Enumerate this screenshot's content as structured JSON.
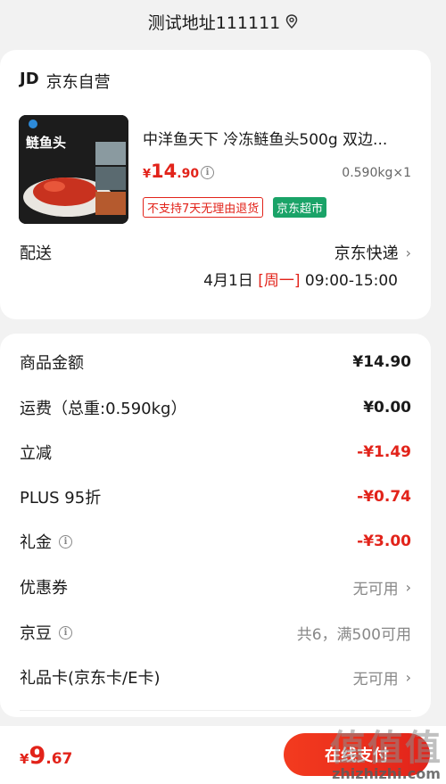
{
  "header": {
    "address": "测试地址111111"
  },
  "shop": {
    "logo": "JD",
    "name": "京东自营"
  },
  "product": {
    "title": "中洋鱼天下 冷冻鲢鱼头500g 双边...",
    "image_label": "鲢鱼头",
    "price_symbol": "¥",
    "price_int": "14",
    "price_dec": ".90",
    "quantity": "0.590kg×1",
    "tag_return": "不支持7天无理由退货",
    "tag_market": "京东超市"
  },
  "delivery": {
    "label": "配送",
    "method": "京东快递",
    "date": "4月1日",
    "weekday": "[周一]",
    "time": "09:00-15:00"
  },
  "summary": [
    {
      "label": "商品金额",
      "value": "¥14.90"
    },
    {
      "label": "运费（总重:0.590kg）",
      "value": "¥0.00"
    },
    {
      "label": "立减",
      "value": "-¥1.49"
    },
    {
      "label": "PLUS 95折",
      "value": "-¥0.74"
    },
    {
      "label": "礼金",
      "value": "-¥3.00"
    },
    {
      "label": "优惠券",
      "value": "无可用"
    },
    {
      "label": "京豆",
      "value": "共6，满500可用"
    },
    {
      "label": "礼品卡(京东卡/E卡)",
      "value": "无可用"
    }
  ],
  "footer": {
    "total_symbol": "¥",
    "total_int": "9",
    "total_dec": ".67",
    "pay_label": "在线支付"
  },
  "watermark": {
    "glyphs": "值值值",
    "site": "zhizhizhi.com"
  },
  "colors": {
    "accent": "#e2231a",
    "market_green": "#1aa368"
  }
}
